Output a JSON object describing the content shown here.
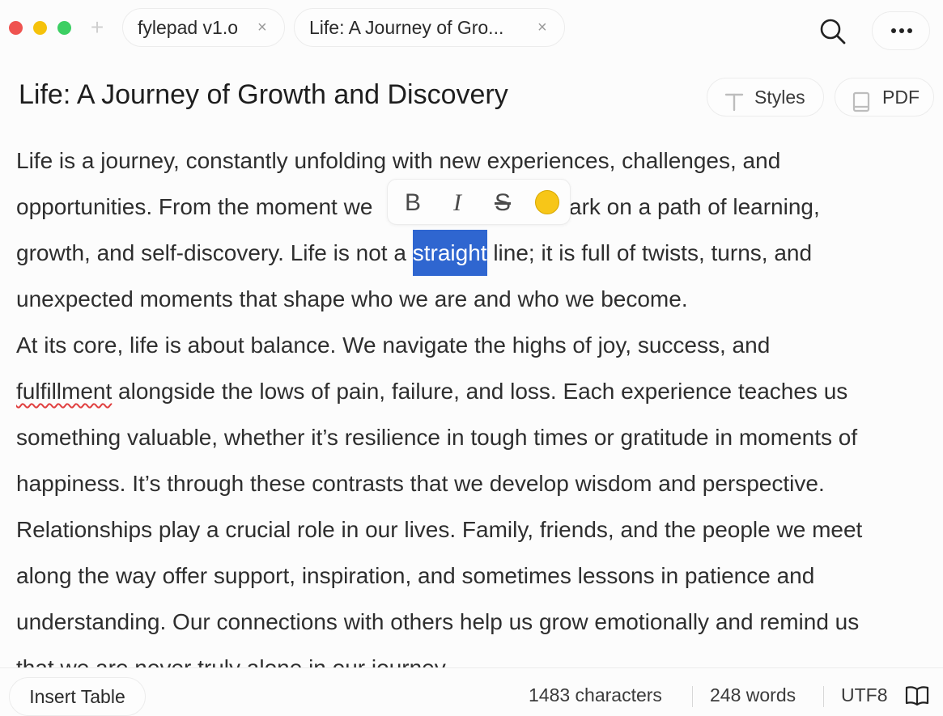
{
  "window": {
    "traffic_lights": {
      "close": "#ef5350",
      "minimize": "#f5c20b",
      "zoom": "#3ccf63"
    },
    "new_tab_symbol": "+"
  },
  "tabs": [
    {
      "label": "fylepad v1.o",
      "close": "×"
    },
    {
      "label": "Life: A Journey of Gro...",
      "close": "×"
    }
  ],
  "header": {
    "title": "Life: A Journey of Growth and Discovery",
    "styles_label": "Styles",
    "pdf_label": "PDF"
  },
  "editor": {
    "lines": [
      {
        "text": "Life is a journey, constantly unfolding with new experiences, challenges, and"
      },
      {
        "before": "opportunities. From the moment we",
        "after": "bark on a path of learning,"
      },
      {
        "before": "growth, and self-discovery. Life is not a ",
        "selected": "straight",
        "after": " line; it is full of twists, turns, and"
      },
      {
        "text": "unexpected moments that shape who we are and who we become."
      },
      {
        "text": "At its core, life is about balance. We navigate the highs of joy, success, and"
      },
      {
        "misspelled": "fulfillment",
        "after": " alongside the lows of pain, failure, and loss. Each experience teaches us"
      },
      {
        "text": "something valuable, whether it’s resilience in tough times or gratitude in moments of"
      },
      {
        "text": "happiness. It’s through these contrasts that we develop wisdom and perspective."
      },
      {
        "text": "Relationships play a crucial role in our lives. Family, friends, and the people we meet"
      },
      {
        "text": "along the way offer support, inspiration, and sometimes lessons in patience and"
      },
      {
        "text": "understanding. Our connections with others help us grow emotionally and remind us"
      },
      {
        "text": "that we are never truly alone in our journey."
      }
    ],
    "selection_color": "#2f66d0"
  },
  "format_toolbar": {
    "bold": "B",
    "italic": "I",
    "strike": "S",
    "highlight_color": "#f7c618"
  },
  "statusbar": {
    "insert_table_label": "Insert Table",
    "characters": "1483 characters",
    "words": "248 words",
    "encoding": "UTF8"
  }
}
